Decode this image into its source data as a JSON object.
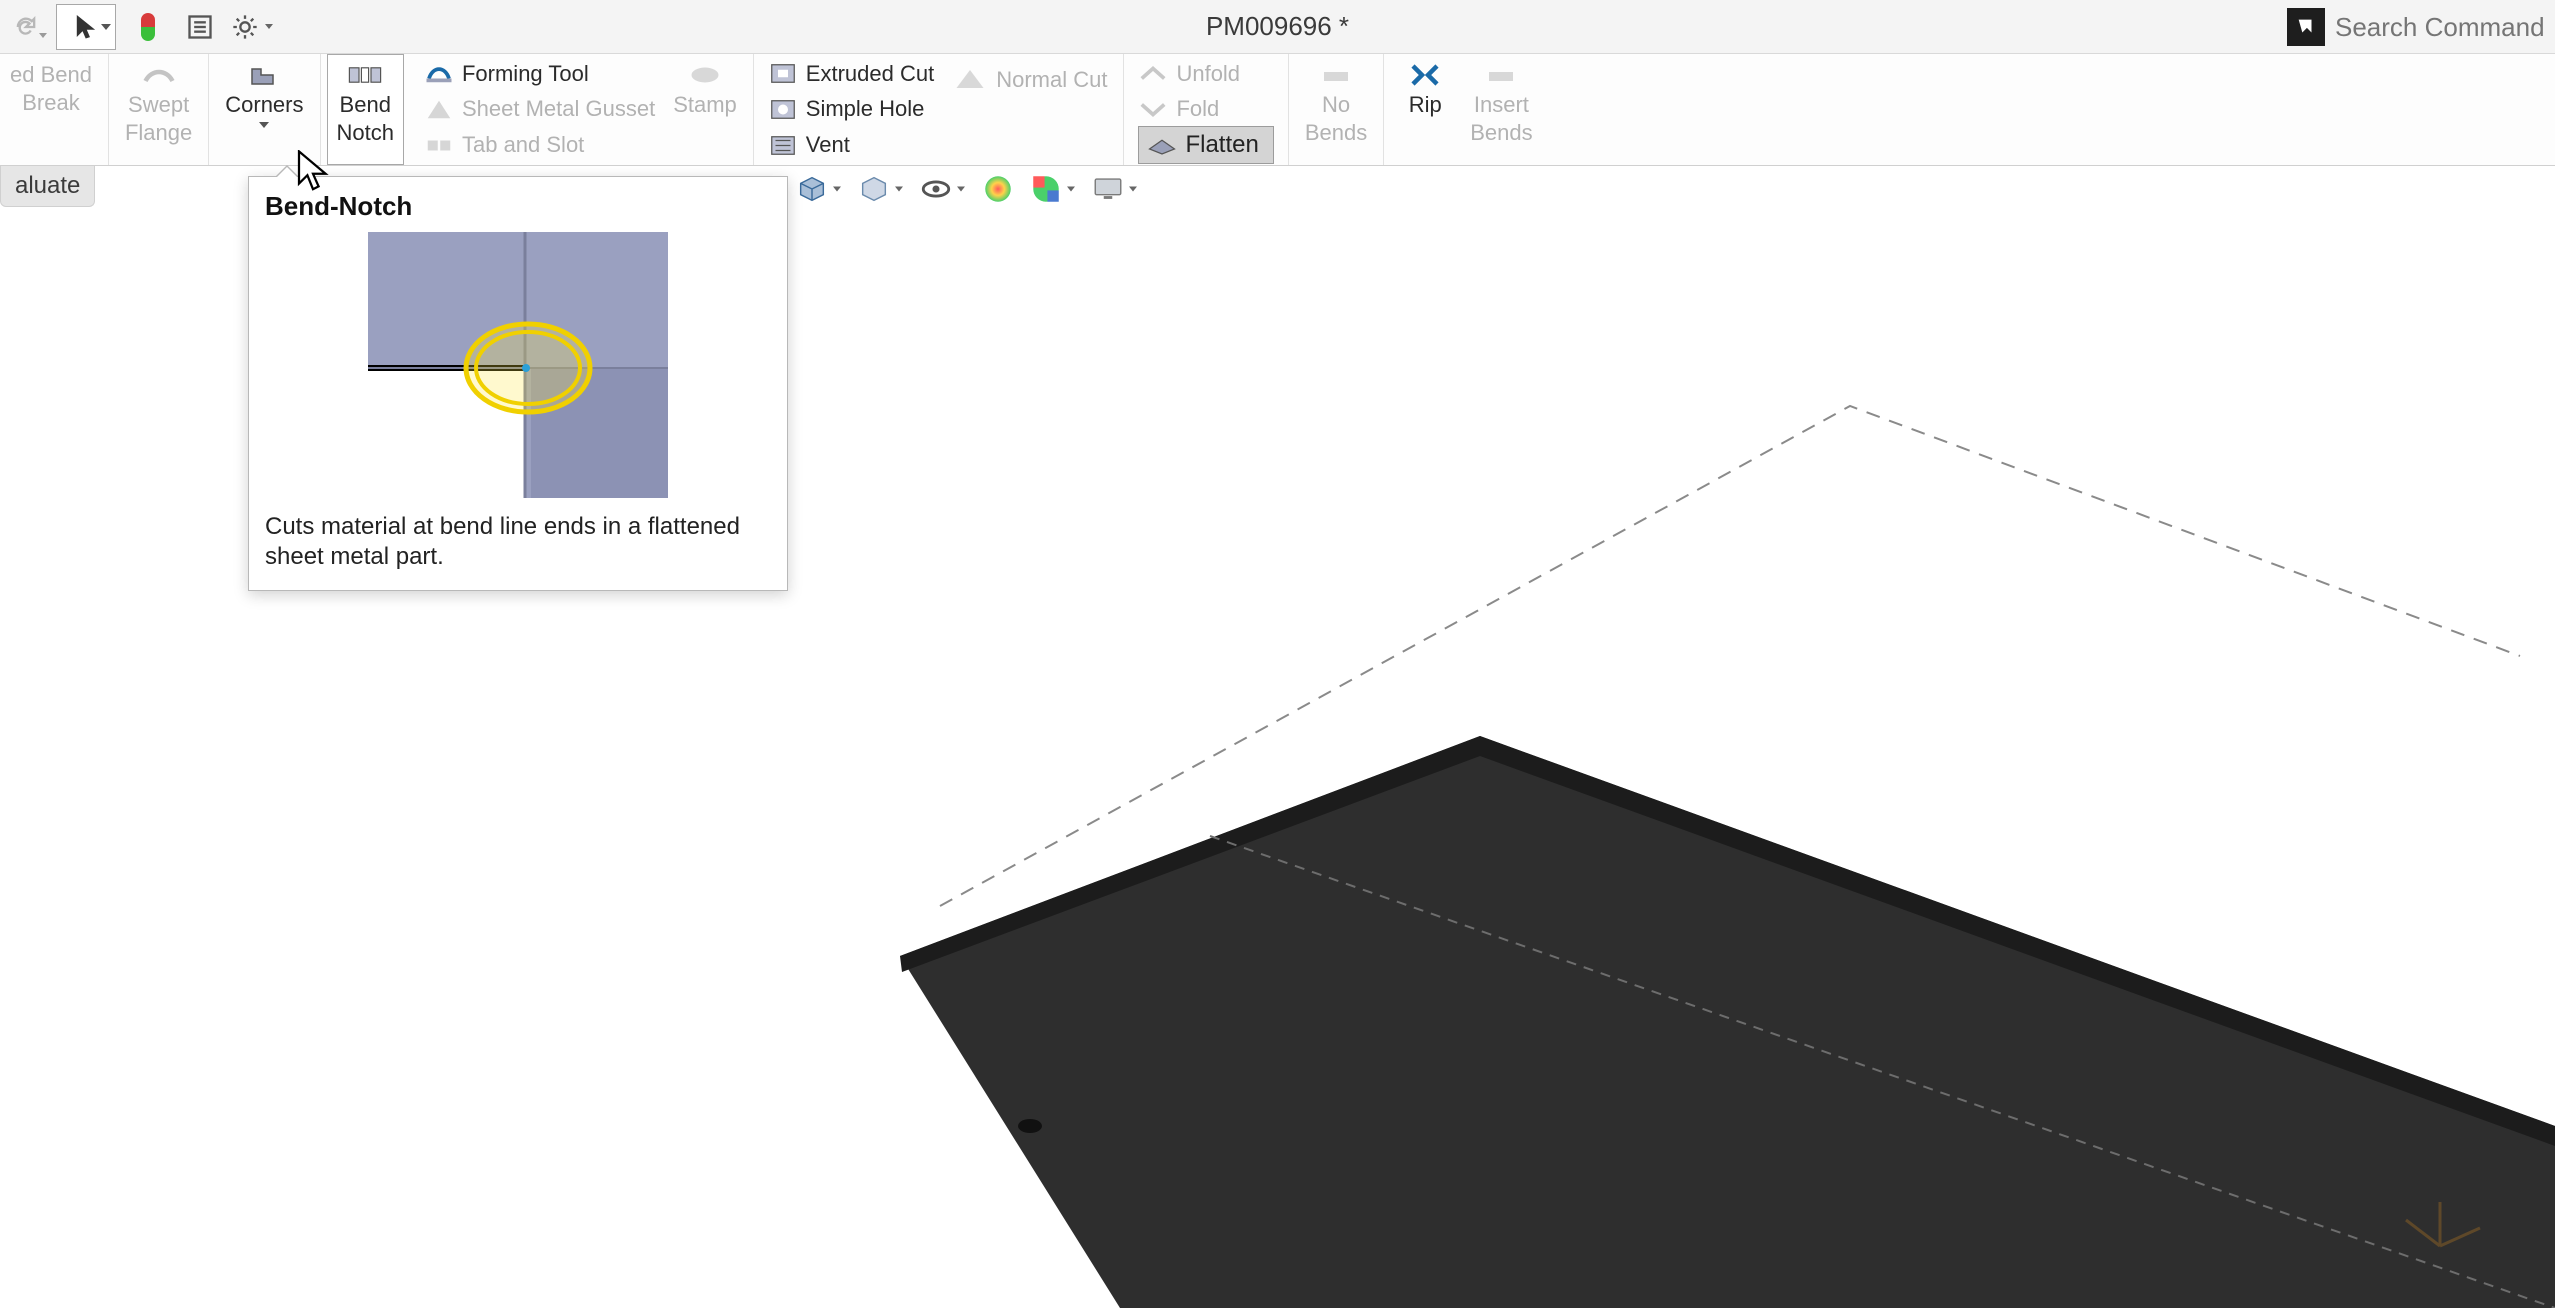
{
  "title": "PM009696 *",
  "search_placeholder": "Search Command",
  "ribbon": {
    "ed_bend": "ed Bend",
    "break": "Break",
    "swept": "Swept",
    "flange": "Flange",
    "corners": "Corners",
    "bend": "Bend",
    "notch": "Notch",
    "forming": "Forming Tool",
    "gusset": "Sheet Metal Gusset",
    "tabslot": "Tab and Slot",
    "stamp": "Stamp",
    "extruded": "Extruded Cut",
    "simple": "Simple Hole",
    "vent": "Vent",
    "normal": "Normal Cut",
    "unfold": "Unfold",
    "fold": "Fold",
    "flatten": "Flatten",
    "nobends1": "No",
    "nobends2": "Bends",
    "rip": "Rip",
    "insert1": "Insert",
    "insert2": "Bends"
  },
  "subtab": {
    "evaluate": "aluate"
  },
  "tooltip": {
    "title": "Bend-Notch",
    "desc": "Cuts material at bend line ends in a flattened sheet metal part."
  },
  "colors": {
    "disabled": "#b2b2b2",
    "enabled": "#2b2b2b",
    "flatten_bg": "#d4d4d4"
  },
  "hud_icons": [
    "view-cube-icon",
    "section-view-icon",
    "eye-icon",
    "appearance-icon",
    "scene-icon",
    "display-icon"
  ]
}
